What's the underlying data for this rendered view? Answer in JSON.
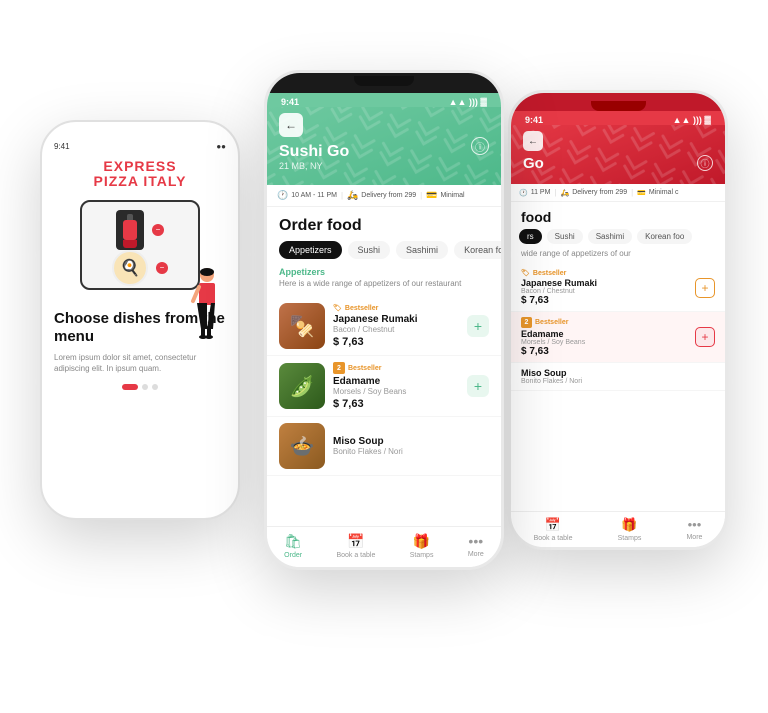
{
  "left_phone": {
    "time": "9:41",
    "logo_line1": "EXPRESS",
    "logo_line2": "PIZZA ITALY",
    "heading": "Choose dishes from the menu",
    "subtext": "Lorem ipsum dolor sit amet, consectetur adipiscing elit. In ipsum quam.",
    "dots": [
      "active",
      "inactive",
      "inactive"
    ]
  },
  "center_phone": {
    "time": "9:41",
    "signal": "▲▲▲",
    "wifi": "WiFi",
    "battery": "100",
    "back_label": "←",
    "restaurant_name": "Sushi Go",
    "restaurant_address": "21 MB, NY",
    "info_icon": "ⓘ",
    "info_bar": [
      {
        "icon": "🕐",
        "text": "10 AM - 11 PM"
      },
      {
        "icon": "🛵",
        "text": "Delivery from 299"
      },
      {
        "icon": "💳",
        "text": "Minimal"
      }
    ],
    "section_title": "Order food",
    "tabs": [
      {
        "label": "Appetizers",
        "active": true
      },
      {
        "label": "Sushi",
        "active": false
      },
      {
        "label": "Sashimi",
        "active": false
      },
      {
        "label": "Korean fo",
        "active": false
      }
    ],
    "category_label": "Appetizers",
    "category_desc": "Here is a wide range of appetizers of our restaurant",
    "food_items": [
      {
        "badge": "Bestseller",
        "badge_icon": "🏷",
        "name": "Japanese Rumaki",
        "sub": "Bacon / Chestnut",
        "price": "$ 7,63",
        "img_class": "food-img-1"
      },
      {
        "badge": "Bestseller",
        "badge_num": "2",
        "name": "Edamame",
        "sub": "Morsels / Soy Beans",
        "price": "$ 7,63",
        "img_class": "food-img-2"
      },
      {
        "badge": "",
        "name": "Miso Soup",
        "sub": "Bonito Flakes / Nori",
        "price": "",
        "img_class": "food-img-3"
      }
    ],
    "nav_items": [
      {
        "icon": "🛍",
        "label": "Order",
        "active": true
      },
      {
        "icon": "📅",
        "label": "Book a table",
        "active": false
      },
      {
        "icon": "🎁",
        "label": "Stamps",
        "active": false
      },
      {
        "icon": "•••",
        "label": "More",
        "active": false
      }
    ]
  },
  "right_phone": {
    "time": "9:41",
    "restaurant_name_partial": "Go",
    "info_bar": [
      {
        "icon": "🕐",
        "text": "11 PM"
      },
      {
        "icon": "🛵",
        "text": "Delivery from 299"
      },
      {
        "icon": "💳",
        "text": "Minimal c"
      }
    ],
    "section_title": "food",
    "tabs": [
      {
        "label": "rs",
        "active": true
      },
      {
        "label": "Sushi",
        "active": false
      },
      {
        "label": "Sashimi",
        "active": false
      },
      {
        "label": "Korean foo",
        "active": false
      }
    ],
    "category_desc": "wide range of appetizers of our",
    "food_items": [
      {
        "badge": "Bestseller",
        "name": "Japanese Rumaki",
        "sub": "Bacon / Chestnut",
        "price": "$ 7,63",
        "highlighted": false
      },
      {
        "badge": "Bestseller",
        "badge_num": "2",
        "name": "Edamame",
        "sub": "Morsels / Soy Beans",
        "price": "$ 7,63",
        "highlighted": true
      },
      {
        "badge": "",
        "name": "Miso Soup",
        "sub": "Bonito Flakes / Nori",
        "price": "",
        "highlighted": false
      }
    ],
    "nav_items": [
      {
        "icon": "📅",
        "label": "Book a table",
        "active": false
      },
      {
        "icon": "🎁",
        "label": "Stamps",
        "active": false
      },
      {
        "icon": "•••",
        "label": "More",
        "active": false
      }
    ]
  },
  "colors": {
    "green_primary": "#4db88a",
    "green_light": "#6ec9a0",
    "red_primary": "#e63946",
    "orange_badge": "#e8952a"
  }
}
